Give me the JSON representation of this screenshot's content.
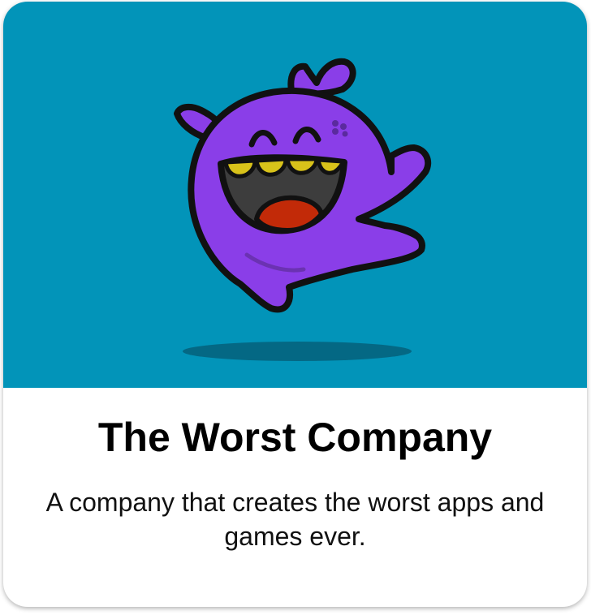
{
  "card": {
    "title": "The Worst Company",
    "description": "A company that creates the worst apps and games ever."
  },
  "colors": {
    "hero_background": "#0294b9",
    "mascot_body": "#8a3ee8",
    "mascot_outline": "#111111",
    "mascot_mouth": "#3d3d3d",
    "mascot_tongue": "#c22a08",
    "mascot_teeth": "#d8c21a",
    "shadow": "#05607a"
  },
  "icons": {
    "mascot": "purple-ghost-mascot-illustration"
  }
}
